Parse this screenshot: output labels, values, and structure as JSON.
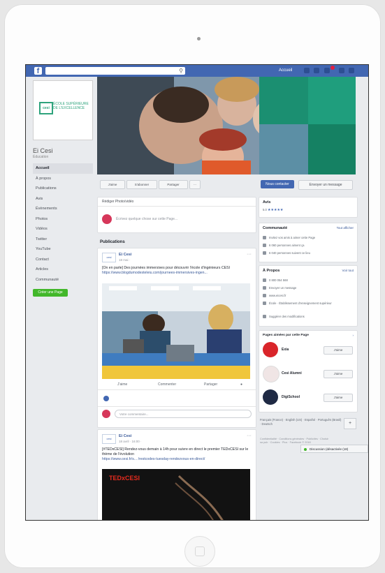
{
  "topbar": {
    "accueil": "Accueil"
  },
  "left": {
    "page_name": "Ei Cesi",
    "page_sub": "Éducation",
    "logo_mark": "cesi",
    "logo_text": "ÉCOLE SUPÉRIEURE DE L'EXCELLENCE",
    "nav": [
      "Accueil",
      "À propos",
      "Publications",
      "Avis",
      "Évènements",
      "Photos",
      "Vidéos",
      "Twitter",
      "YouTube",
      "Contact",
      "Articles",
      "Communauté"
    ],
    "create_button": "Créer une Page"
  },
  "actions": {
    "like": "J'aime",
    "follow": "S'abonner",
    "share": "Partager",
    "more": "···",
    "contact": "Nous contacter",
    "message": "Envoyer un message"
  },
  "composer": {
    "tabs": "Rédiger  Photo/vidéo",
    "placeholder": "Écrivez quelque chose sur cette Page..."
  },
  "publications_label": "Publications",
  "post1": {
    "author": "Ei Cesi",
    "date": "18 mai · ",
    "text": "[On en parle] Des journées immersives pour découvrir l'école d'ingénieurs CESI",
    "link": "https://www.blogdumodesteleiu.com/journees-immersives-ingen...",
    "like": "J'aime",
    "comment": "Commenter",
    "share": "Partager",
    "comment_placeholder": "Votre commentaire..."
  },
  "post2": {
    "author": "Ei Cesi",
    "date": "18 avril · 16:00 · ",
    "text": "[#TEDxCESI] Rendez-vous demain à 14h pour suivre en direct le premier TEDxCESI sur le thème de l'évolution",
    "link": "https://www.cesi.fr/s... /restcodes-tuesday-rendezvous-en-direct/",
    "ted_logo": "TEDxCESI"
  },
  "right": {
    "avis_title": "Avis",
    "avis_score": "5.0",
    "avis_stars": "★★★★★",
    "community_title": "Communauté",
    "community_link": "Tout afficher",
    "community_lines": [
      "Invitez vos amis à aimer cette Page",
      "6 060 personnes aiment ça",
      "6 040 personnes suivent ce lieu"
    ],
    "about_title": "À Propos",
    "about_link": "Voir tout",
    "about_lines": [
      "0 800 054 568",
      "Envoyer un message",
      "www.eicesi.fr",
      "École · Établissement d'enseignement supérieur",
      "Suggérer des modifications"
    ],
    "liked_title": "Pages aimées par cette Page",
    "liked_pages": [
      {
        "name": "Exia",
        "button": "J'aime"
      },
      {
        "name": "Cesi Alumni",
        "button": "J'aime"
      },
      {
        "name": "DigiSchool",
        "button": "J'aime"
      }
    ],
    "footer_lang": "Français (France) · English (US) · Español · Português (Brasil) · Deutsch",
    "footer_links": "Confidentialité · Conditions générales · Publicités · Choisir sa pub · Cookies · Plus · Facebook © 2018",
    "chat": "Discussion (désactivée (18)"
  }
}
